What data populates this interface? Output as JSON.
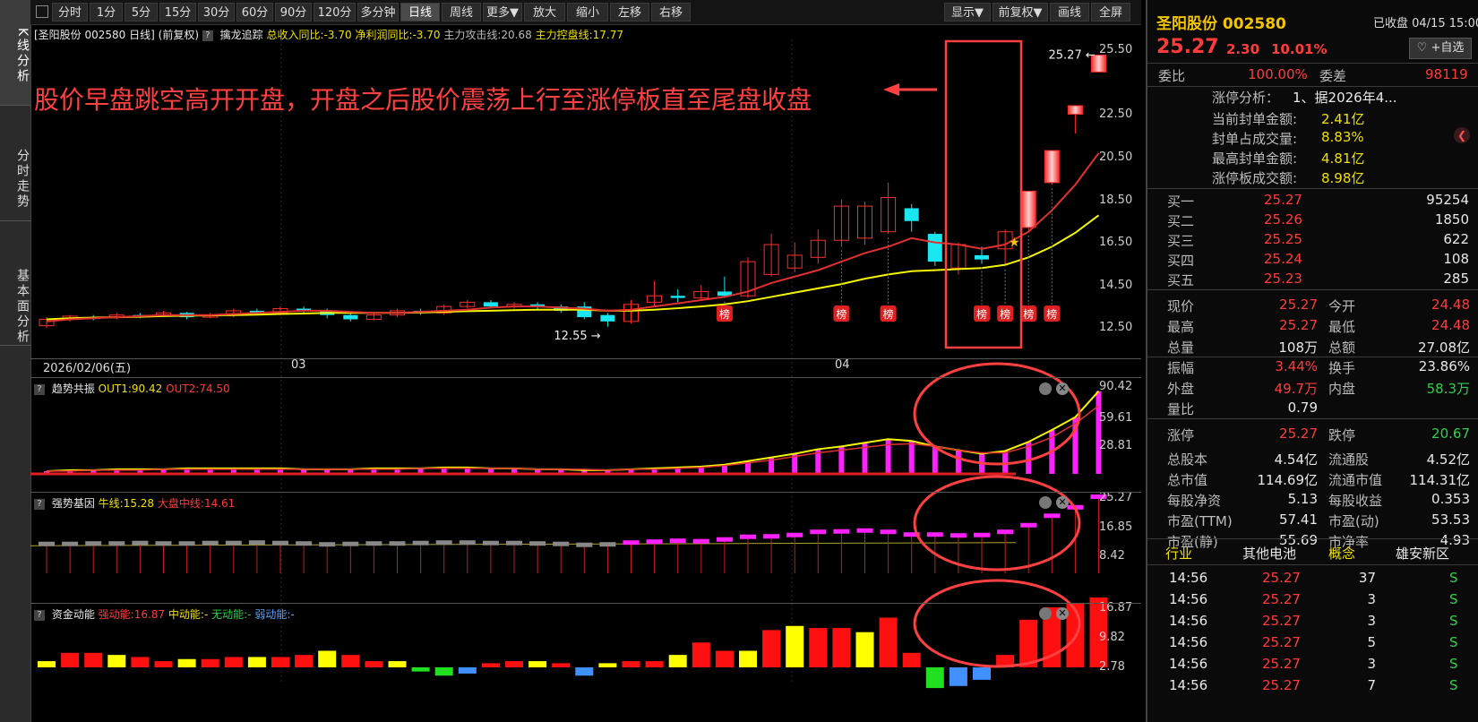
{
  "left_tabs": [
    {
      "label": "K线分析"
    },
    {
      "label": "分时走势"
    },
    {
      "label": "基本面分析"
    }
  ],
  "toolbar": {
    "left_buttons": [
      "分时",
      "1分",
      "5分",
      "15分",
      "30分",
      "60分",
      "90分",
      "120分",
      "多分钟",
      "日线",
      "周线",
      "更多▼",
      "放大",
      "缩小",
      "左移",
      "右移"
    ],
    "right_buttons": [
      "显示▼",
      "前复权▼",
      "画线",
      "全屏"
    ],
    "selected": "日线"
  },
  "main_chart": {
    "title": "[圣阳股份 002580 日线]",
    "adjust": "(前复权)",
    "indicator_name": "擒龙追踪",
    "rev_yoy": "总收入同比:-3.70",
    "profit_yoy": "净利润同比:-3.70",
    "attack_line": "主力攻击线:20.68",
    "control_line": "主力控盘线:17.77",
    "annotation": "股价早盘跳空高开开盘，开盘之后股价震荡上行至涨停板直至尾盘收盘",
    "high_label": "25.27",
    "low_label": "12.55",
    "rank_badge": "榜",
    "date_labels": [
      "2026/02/06(五)",
      "03",
      "04"
    ],
    "y_ticks": [
      "25.50",
      "22.50",
      "20.50",
      "18.50",
      "16.50",
      "14.50",
      "12.50"
    ]
  },
  "panel1": {
    "name": "趋势共振",
    "v1": "OUT1:90.42",
    "v2": "OUT2:74.50",
    "y_ticks": [
      "90.42",
      "59.61",
      "28.81"
    ]
  },
  "panel2": {
    "name": "强势基因",
    "v1": "牛线:15.28",
    "v2": "大盘中线:14.61",
    "y_ticks": [
      "25.27",
      "16.85",
      "8.42"
    ]
  },
  "panel3": {
    "name": "资金动能",
    "v1": "强动能:16.87",
    "v2": "中动能:-",
    "v3": "无动能:-",
    "v4": "弱动能:-",
    "y_ticks": [
      "16.87",
      "9.82",
      "2.78"
    ]
  },
  "colors": {
    "up": "#ff2b2b",
    "down": "#19e6f0",
    "ma_fast": "#e03030",
    "ma_slow": "#f5f500",
    "accent": "#ff4040"
  },
  "stock": {
    "name_code": "圣阳股份 002580",
    "status": "已收盘 04/15 15:00",
    "price": "25.27",
    "change": "2.30",
    "pct": "10.01%",
    "watch_btn": "+自选",
    "weibi_label": "委比",
    "weibi": "100.00%",
    "weicha_label": "委差",
    "weicha": "98119",
    "limit_title": "涨停分析：",
    "limit_desc": "1、据2026年4...",
    "limit_rows": [
      {
        "label": "当前封单金额:",
        "value": "2.41亿"
      },
      {
        "label": "封单占成交量:",
        "value": "8.83%"
      },
      {
        "label": "最高封单金额:",
        "value": "4.81亿"
      },
      {
        "label": "涨停板成交额:",
        "value": "8.98亿"
      }
    ],
    "bids": [
      {
        "label": "买一",
        "price": "25.27",
        "vol": "95254"
      },
      {
        "label": "买二",
        "price": "25.26",
        "vol": "1850"
      },
      {
        "label": "买三",
        "price": "25.25",
        "vol": "622"
      },
      {
        "label": "买四",
        "price": "25.24",
        "vol": "108"
      },
      {
        "label": "买五",
        "price": "25.23",
        "vol": "285"
      }
    ],
    "quote": [
      {
        "l1": "现价",
        "v1": "25.27",
        "c1": "red",
        "l2": "今开",
        "v2": "24.48",
        "c2": "red"
      },
      {
        "l1": "最高",
        "v1": "25.27",
        "c1": "red",
        "l2": "最低",
        "v2": "24.48",
        "c2": "red"
      },
      {
        "l1": "总量",
        "v1": "108万",
        "c1": "wht",
        "l2": "总额",
        "v2": "27.08亿",
        "c2": "wht"
      },
      {
        "l1": "振幅",
        "v1": "3.44%",
        "c1": "red",
        "l2": "换手",
        "v2": "23.86%",
        "c2": "wht"
      },
      {
        "l1": "外盘",
        "v1": "49.7万",
        "c1": "red",
        "l2": "内盘",
        "v2": "58.3万",
        "c2": "grn"
      },
      {
        "l1": "量比",
        "v1": "0.79",
        "c1": "wht",
        "l2": "",
        "v2": "",
        "c2": "wht"
      },
      {
        "l1": "涨停",
        "v1": "25.27",
        "c1": "red",
        "l2": "跌停",
        "v2": "20.67",
        "c2": "grn"
      },
      {
        "l1": "总股本",
        "v1": "4.54亿",
        "c1": "wht",
        "l2": "流通股",
        "v2": "4.52亿",
        "c2": "wht"
      },
      {
        "l1": "总市值",
        "v1": "114.69亿",
        "c1": "wht",
        "l2": "流通市值",
        "v2": "114.31亿",
        "c2": "wht"
      },
      {
        "l1": "每股净资",
        "v1": "5.13",
        "c1": "wht",
        "l2": "每股收益",
        "v2": "0.353",
        "c2": "wht"
      },
      {
        "l1": "市盈(TTM)",
        "v1": "57.41",
        "c1": "wht",
        "l2": "市盈(动)",
        "v2": "53.53",
        "c2": "wht"
      },
      {
        "l1": "市盈(静)",
        "v1": "55.69",
        "c1": "wht",
        "l2": "市净率",
        "v2": "4.93",
        "c2": "wht"
      }
    ],
    "industry_label": "行业",
    "industry": "其他电池",
    "concept_label": "概念",
    "concept": "雄安新区",
    "ticks": [
      {
        "time": "14:56",
        "price": "25.27",
        "vol": "37",
        "dir": "S"
      },
      {
        "time": "14:56",
        "price": "25.27",
        "vol": "3",
        "dir": "S"
      },
      {
        "time": "14:56",
        "price": "25.27",
        "vol": "3",
        "dir": "S"
      },
      {
        "time": "14:56",
        "price": "25.27",
        "vol": "5",
        "dir": "S"
      },
      {
        "time": "14:56",
        "price": "25.27",
        "vol": "3",
        "dir": "S"
      },
      {
        "time": "14:56",
        "price": "25.27",
        "vol": "7",
        "dir": "S"
      }
    ]
  },
  "chart_data": {
    "type": "candlestick",
    "ylim": [
      12.0,
      26.0
    ],
    "candles": [
      {
        "o": 12.6,
        "c": 12.9,
        "h": 13.0,
        "l": 12.5
      },
      {
        "o": 12.9,
        "c": 13.05,
        "h": 13.1,
        "l": 12.8
      },
      {
        "o": 13.0,
        "c": 12.95,
        "h": 13.1,
        "l": 12.85
      },
      {
        "o": 13.0,
        "c": 13.1,
        "h": 13.2,
        "l": 12.9
      },
      {
        "o": 13.1,
        "c": 13.05,
        "h": 13.2,
        "l": 12.95
      },
      {
        "o": 13.05,
        "c": 13.2,
        "h": 13.3,
        "l": 13.0
      },
      {
        "o": 13.2,
        "c": 13.0,
        "h": 13.25,
        "l": 12.9
      },
      {
        "o": 13.0,
        "c": 13.1,
        "h": 13.2,
        "l": 12.95
      },
      {
        "o": 13.1,
        "c": 13.3,
        "h": 13.4,
        "l": 13.0
      },
      {
        "o": 13.3,
        "c": 13.25,
        "h": 13.4,
        "l": 13.1
      },
      {
        "o": 13.2,
        "c": 13.4,
        "h": 13.5,
        "l": 13.1
      },
      {
        "o": 13.4,
        "c": 13.3,
        "h": 13.5,
        "l": 13.2
      },
      {
        "o": 13.3,
        "c": 13.1,
        "h": 13.4,
        "l": 12.95
      },
      {
        "o": 13.1,
        "c": 12.9,
        "h": 13.2,
        "l": 12.8
      },
      {
        "o": 12.9,
        "c": 13.1,
        "h": 13.2,
        "l": 12.85
      },
      {
        "o": 13.1,
        "c": 13.3,
        "h": 13.4,
        "l": 13.0
      },
      {
        "o": 13.3,
        "c": 13.2,
        "h": 13.4,
        "l": 13.1
      },
      {
        "o": 13.2,
        "c": 13.5,
        "h": 13.6,
        "l": 13.1
      },
      {
        "o": 13.5,
        "c": 13.7,
        "h": 13.8,
        "l": 13.4
      },
      {
        "o": 13.7,
        "c": 13.5,
        "h": 13.8,
        "l": 13.4
      },
      {
        "o": 13.5,
        "c": 13.6,
        "h": 13.7,
        "l": 13.4
      },
      {
        "o": 13.6,
        "c": 13.5,
        "h": 13.7,
        "l": 13.3
      },
      {
        "o": 13.5,
        "c": 13.3,
        "h": 13.6,
        "l": 13.2
      },
      {
        "o": 13.5,
        "c": 13.0,
        "h": 13.7,
        "l": 12.9
      },
      {
        "o": 13.1,
        "c": 12.8,
        "h": 13.2,
        "l": 12.55
      },
      {
        "o": 12.8,
        "c": 13.6,
        "h": 13.8,
        "l": 12.7
      },
      {
        "o": 13.7,
        "c": 14.0,
        "h": 14.7,
        "l": 13.5
      },
      {
        "o": 14.0,
        "c": 13.9,
        "h": 14.3,
        "l": 13.7
      },
      {
        "o": 13.9,
        "c": 14.2,
        "h": 14.5,
        "l": 13.8
      },
      {
        "o": 14.2,
        "c": 14.0,
        "h": 14.9,
        "l": 13.9
      },
      {
        "o": 14.0,
        "c": 15.6,
        "h": 15.8,
        "l": 13.9
      },
      {
        "o": 15.0,
        "c": 16.4,
        "h": 16.9,
        "l": 14.9
      },
      {
        "o": 15.3,
        "c": 15.9,
        "h": 16.5,
        "l": 15.1
      },
      {
        "o": 15.8,
        "c": 16.6,
        "h": 17.1,
        "l": 15.5
      },
      {
        "o": 16.6,
        "c": 18.2,
        "h": 18.5,
        "l": 16.3
      },
      {
        "o": 16.7,
        "c": 18.2,
        "h": 18.4,
        "l": 16.4
      },
      {
        "o": 17.0,
        "c": 18.6,
        "h": 19.3,
        "l": 16.9
      },
      {
        "o": 18.1,
        "c": 17.5,
        "h": 18.3,
        "l": 17.0
      },
      {
        "o": 16.9,
        "c": 15.6,
        "h": 17.0,
        "l": 15.4
      },
      {
        "o": 15.3,
        "c": 16.4,
        "h": 16.5,
        "l": 15.0
      },
      {
        "o": 15.9,
        "c": 15.7,
        "h": 16.3,
        "l": 15.5
      },
      {
        "o": 16.2,
        "c": 17.0,
        "h": 17.1,
        "l": 15.4
      },
      {
        "o": 17.2,
        "c": 18.9,
        "h": 18.9,
        "l": 17.0
      },
      {
        "o": 19.3,
        "c": 20.8,
        "h": 20.8,
        "l": 19.2
      },
      {
        "o": 22.5,
        "c": 22.9,
        "h": 22.9,
        "l": 21.6
      },
      {
        "o": 24.48,
        "c": 25.27,
        "h": 25.27,
        "l": 24.48
      }
    ],
    "ma_fast": [
      12.8,
      12.9,
      12.95,
      13.0,
      13.05,
      13.1,
      13.1,
      13.1,
      13.15,
      13.2,
      13.25,
      13.3,
      13.3,
      13.25,
      13.2,
      13.2,
      13.25,
      13.3,
      13.35,
      13.45,
      13.5,
      13.5,
      13.45,
      13.4,
      13.3,
      13.35,
      13.5,
      13.65,
      13.8,
      13.95,
      14.2,
      14.6,
      14.9,
      15.2,
      15.6,
      16.0,
      16.3,
      16.7,
      16.5,
      16.4,
      16.2,
      16.4,
      17.0,
      18.0,
      19.2,
      20.68
    ],
    "ma_slow": [
      12.9,
      12.95,
      12.98,
      13.0,
      13.02,
      13.05,
      13.07,
      13.08,
      13.1,
      13.12,
      13.15,
      13.17,
      13.2,
      13.2,
      13.2,
      13.2,
      13.22,
      13.25,
      13.28,
      13.3,
      13.33,
      13.35,
      13.35,
      13.35,
      13.3,
      13.3,
      13.35,
      13.42,
      13.5,
      13.6,
      13.75,
      13.95,
      14.15,
      14.35,
      14.55,
      14.8,
      15.0,
      15.15,
      15.2,
      15.25,
      15.3,
      15.45,
      15.8,
      16.3,
      16.95,
      17.77
    ],
    "rank_days": [
      28,
      33,
      35,
      39,
      40,
      41,
      42
    ],
    "panel1_bars": [
      2,
      3,
      3,
      4,
      4,
      5,
      5,
      5,
      6,
      6,
      6,
      6,
      5,
      5,
      5,
      6,
      6,
      6,
      7,
      7,
      6,
      6,
      5,
      5,
      4,
      4,
      5,
      6,
      7,
      8,
      10,
      14,
      18,
      22,
      27,
      30,
      34,
      38,
      36,
      30,
      26,
      22,
      25,
      35,
      48,
      62,
      90.42
    ],
    "panel1_out1": [
      3,
      3,
      4,
      4,
      5,
      5,
      5,
      6,
      6,
      6,
      6,
      6,
      5,
      5,
      5,
      6,
      6,
      6,
      7,
      7,
      6,
      6,
      5,
      5,
      4,
      4,
      5,
      6,
      7,
      8,
      10,
      14,
      18,
      22,
      27,
      30,
      34,
      38,
      36,
      30,
      26,
      22,
      25,
      35,
      48,
      62,
      90.42
    ],
    "panel1_out2": [
      3,
      3,
      3,
      4,
      4,
      4,
      5,
      5,
      5,
      5,
      5,
      5,
      5,
      5,
      5,
      5,
      5,
      6,
      6,
      6,
      6,
      6,
      5,
      5,
      5,
      4,
      5,
      5,
      6,
      7,
      9,
      12,
      15,
      19,
      23,
      26,
      29,
      32,
      33,
      30,
      26,
      23,
      23,
      30,
      40,
      55,
      74.5
    ],
    "panel2_tops": [
      14.6,
      14.7,
      14.7,
      14.8,
      14.8,
      14.9,
      14.8,
      14.8,
      14.9,
      14.9,
      15.0,
      14.9,
      14.8,
      14.6,
      14.7,
      14.8,
      14.8,
      14.9,
      15.0,
      15.0,
      14.9,
      14.9,
      14.8,
      14.7,
      14.5,
      14.6,
      15.0,
      15.2,
      15.4,
      15.3,
      15.7,
      16.3,
      16.4,
      16.7,
      17.4,
      17.5,
      17.7,
      17.4,
      16.8,
      16.8,
      16.6,
      16.7,
      17.4,
      18.9,
      21.0,
      22.9,
      25.27
    ],
    "panel3_bars": [
      1.5,
      3.5,
      3.5,
      3.0,
      2.5,
      1.5,
      2.0,
      2.0,
      2.5,
      2.5,
      2.5,
      3.0,
      4.0,
      3.0,
      1.5,
      1.5,
      -1.0,
      -2.0,
      -1.5,
      1.0,
      1.5,
      1.5,
      1.0,
      -2.0,
      1.0,
      1.5,
      1.5,
      3.0,
      6.0,
      4.0,
      4.0,
      9.0,
      10.0,
      9.5,
      9.5,
      8.5,
      12.0,
      3.5,
      -5.0,
      -4.5,
      -3.0,
      3.0,
      11.5,
      14.5,
      15.5,
      16.87
    ]
  }
}
